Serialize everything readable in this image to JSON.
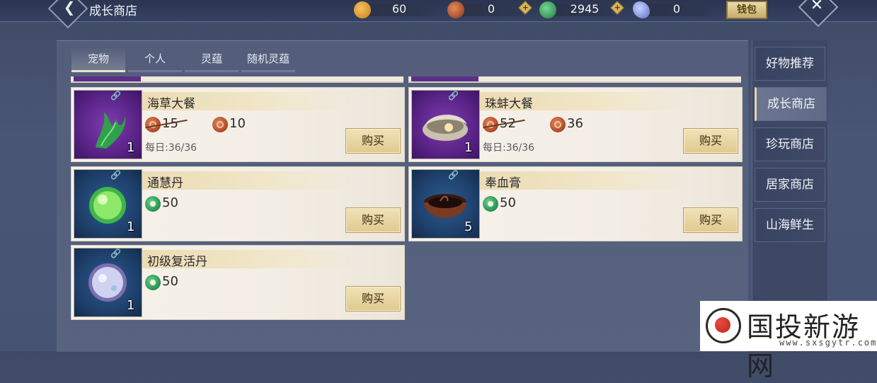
{
  "header": {
    "title": "成长商店",
    "wallet_label": "钱包",
    "currencies": [
      {
        "icon": "gold-bag-icon",
        "value": "60",
        "color": "#e3a437"
      },
      {
        "icon": "copper-coin-icon",
        "value": "0",
        "color": "#c4592f"
      },
      {
        "icon": "jade-icon",
        "value": "2945",
        "color": "#2ea05a"
      },
      {
        "icon": "crystal-icon",
        "value": "0",
        "color": "#8ea2e6"
      }
    ]
  },
  "tabs": [
    {
      "label": "宠物",
      "active": true
    },
    {
      "label": "个人",
      "active": false
    },
    {
      "label": "灵蕴",
      "active": false
    },
    {
      "label": "随机灵蕴",
      "active": false
    }
  ],
  "items": [
    {
      "name": "海草大餐",
      "count": "1",
      "thumb": "seaweed-icon",
      "frame": "purple",
      "old_price": "15",
      "price": "10",
      "currency": "copper",
      "daily": "每日:36/36",
      "buy_label": "购买"
    },
    {
      "name": "珠蚌大餐",
      "count": "1",
      "thumb": "pearl-clam-icon",
      "frame": "purple",
      "old_price": "52",
      "price": "36",
      "currency": "copper",
      "daily": "每日:36/36",
      "buy_label": "购买"
    },
    {
      "name": "通慧丹",
      "count": "1",
      "thumb": "green-pill-icon",
      "frame": "blue",
      "price": "50",
      "currency": "jade",
      "buy_label": "购买"
    },
    {
      "name": "奉血膏",
      "count": "5",
      "thumb": "blood-paste-bowl-icon",
      "frame": "blue",
      "price": "50",
      "currency": "jade",
      "buy_label": "购买"
    },
    {
      "name": "初级复活丹",
      "count": "1",
      "thumb": "revive-pill-icon",
      "frame": "blue",
      "price": "50",
      "currency": "jade",
      "buy_label": "购买"
    }
  ],
  "side_menu": [
    {
      "label": "好物推荐",
      "active": false
    },
    {
      "label": "成长商店",
      "active": true
    },
    {
      "label": "珍玩商店",
      "active": false
    },
    {
      "label": "居家商店",
      "active": false
    },
    {
      "label": "山海鲜生",
      "active": false
    }
  ],
  "watermark": {
    "title": "国投新游网",
    "url": "www.sxsgytr.com"
  }
}
